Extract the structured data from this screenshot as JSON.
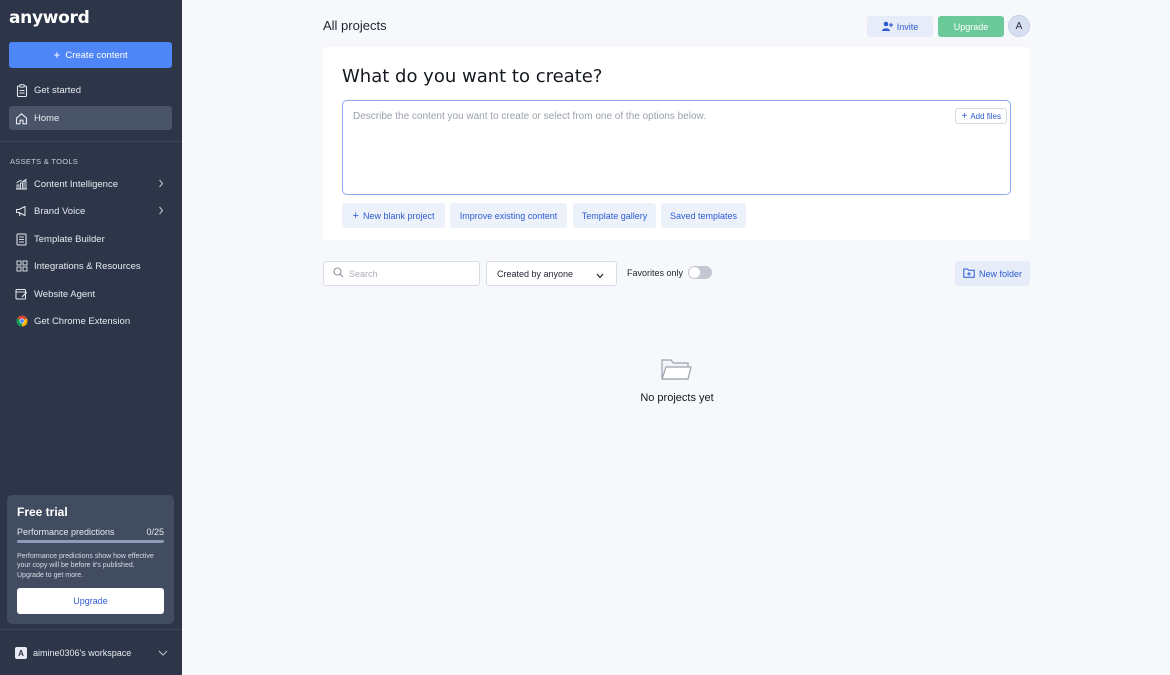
{
  "app": {
    "logo": "anyword"
  },
  "sidebar": {
    "create_label": "Create content",
    "top_items": [
      {
        "label": "Get started"
      },
      {
        "label": "Home"
      }
    ],
    "section_label": "ASSETS & TOOLS",
    "tools": [
      {
        "label": "Content Intelligence"
      },
      {
        "label": "Brand Voice"
      },
      {
        "label": "Template Builder"
      },
      {
        "label": "Integrations & Resources"
      },
      {
        "label": "Website Agent"
      },
      {
        "label": "Get Chrome Extension"
      }
    ],
    "trial": {
      "title": "Free trial",
      "metric_label": "Performance predictions",
      "metric_value": "0/25",
      "progress": 0,
      "description": "Performance predictions show how effective your copy will be before it's published. Upgrade to get more.",
      "button": "Upgrade"
    },
    "workspace": {
      "initial": "A",
      "name": "aimine0306's workspace"
    }
  },
  "header": {
    "title": "All projects",
    "invite": "Invite",
    "upgrade": "Upgrade",
    "avatar_initial": "A"
  },
  "create_card": {
    "heading": "What do you want to create?",
    "placeholder": "Describe the content you want to create or select from one of the options below.",
    "add_files": "Add files",
    "options": [
      {
        "label": "New blank project"
      },
      {
        "label": "Improve existing content"
      },
      {
        "label": "Template gallery"
      },
      {
        "label": "Saved templates"
      }
    ]
  },
  "filters": {
    "search_placeholder": "Search",
    "created_by": "Created by anyone",
    "favorites_label": "Favorites only",
    "favorites_on": false,
    "new_folder": "New folder"
  },
  "empty_state": {
    "text": "No projects yet"
  },
  "colors": {
    "sidebar_bg": "#2d3648",
    "primary": "#4f86f7",
    "upgrade_green": "#6bc99a",
    "link_blue": "#2d5bd2"
  }
}
